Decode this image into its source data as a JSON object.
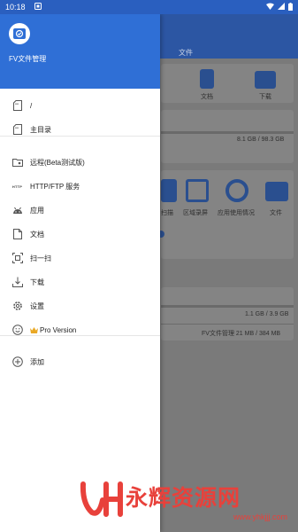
{
  "status_bar": {
    "time": "10:18"
  },
  "drawer": {
    "app_name": "FV文件管理",
    "items": [
      {
        "label": "/"
      },
      {
        "label": "主目录"
      },
      {
        "label": "远程(Beta测试版)"
      },
      {
        "label": "HTTP/FTP 服务",
        "icon_text": "HTTP"
      },
      {
        "label": "应用"
      },
      {
        "label": "文档"
      },
      {
        "label": "扫一扫"
      },
      {
        "label": "下载"
      },
      {
        "label": "设置"
      },
      {
        "label": "Pro Version"
      },
      {
        "label": "添加"
      }
    ]
  },
  "background": {
    "tab": "文件",
    "shortcuts": [
      "文档",
      "下载"
    ],
    "storage": "8.1 GB / 98.3 GB",
    "tools": [
      "扫描",
      "区域录屏",
      "应用使用情况",
      "文件"
    ],
    "storage2": "1.1 GB / 3.9 GB",
    "app_size": "FV文件管理  21 MB / 384 MB"
  },
  "watermark": {
    "title": "永辉资源网",
    "url": "www.yhkjjj.com"
  },
  "colors": {
    "primary": "#2f6fd6",
    "watermark": "#e8413b"
  }
}
